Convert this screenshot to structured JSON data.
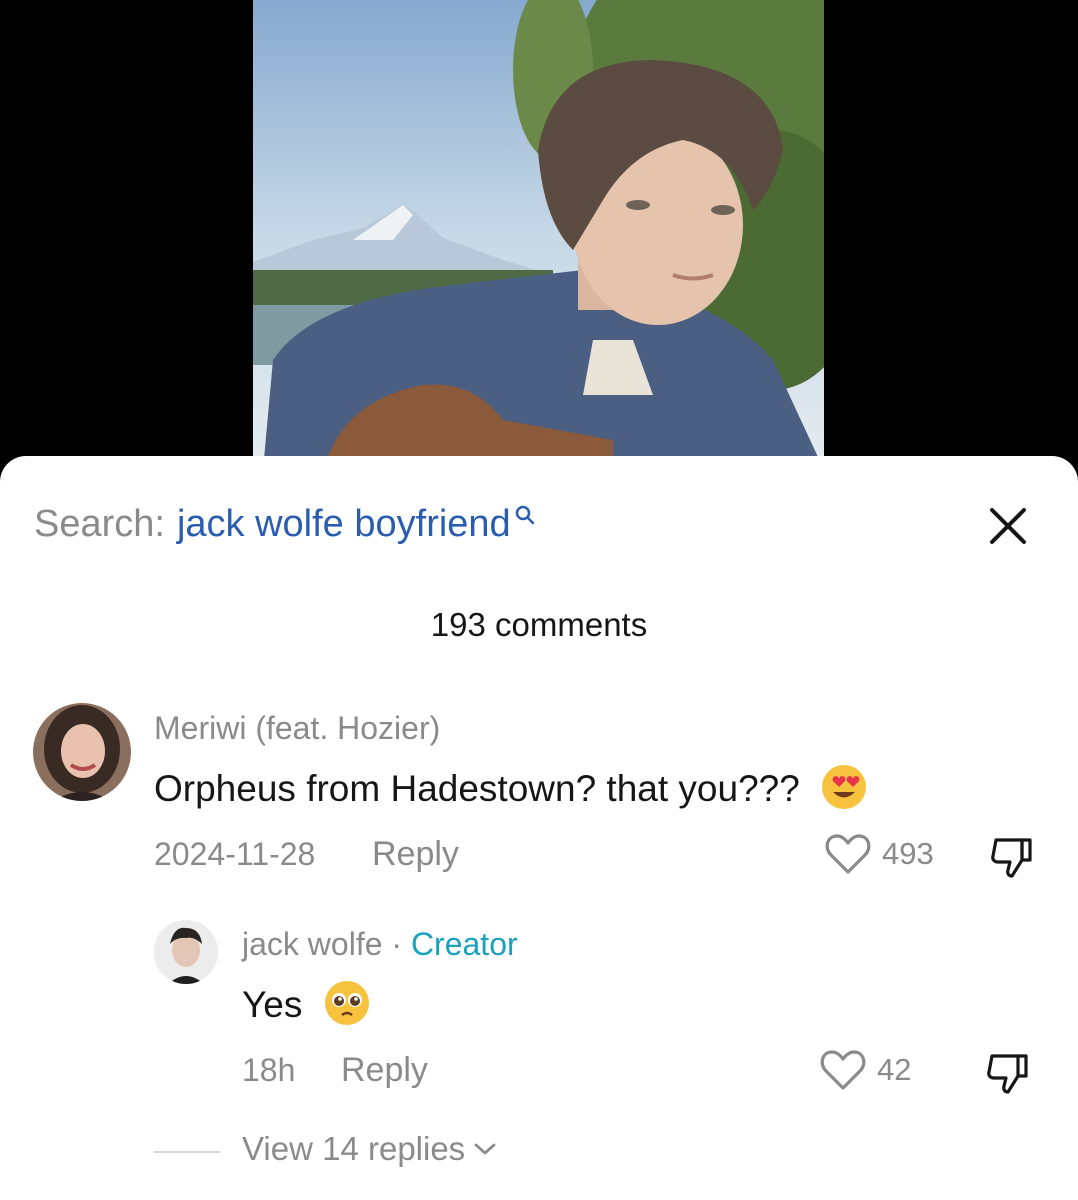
{
  "search": {
    "prefix": "Search:",
    "query": "jack wolfe boyfriend"
  },
  "comments_header": {
    "count_label": "193 comments"
  },
  "comments": [
    {
      "username": "Meriwi (feat. Hozier)",
      "text": "Orpheus from Hadestown? that you???",
      "emoji": "heart-eyes-emoji",
      "date": "2024-11-28",
      "reply_label": "Reply",
      "likes": "493"
    }
  ],
  "reply": {
    "username": "jack wolfe",
    "separator": " · ",
    "badge": "Creator",
    "text": "Yes",
    "emoji": "pleading-face-emoji",
    "date": "18h",
    "reply_label": "Reply",
    "likes": "42"
  },
  "view_replies": {
    "label": "View 14 replies"
  },
  "colors": {
    "search_query": "#2a5db0",
    "creator_badge": "#19a2c0",
    "muted": "#8a8a8a"
  }
}
